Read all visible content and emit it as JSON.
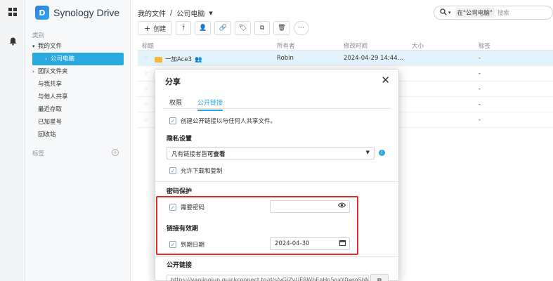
{
  "app": {
    "name": "Synology Drive",
    "logo_letter": "D"
  },
  "rail": {
    "icons": [
      "grid-icon",
      "bell-icon"
    ]
  },
  "sidebar": {
    "category_label": "类别",
    "items": [
      {
        "label": "我的文件",
        "arrow": "▾"
      },
      {
        "label": "公司电脑",
        "arrow": "›",
        "active": true
      },
      {
        "label": "团队文件夹",
        "arrow": "›"
      },
      {
        "label": "与我共享"
      },
      {
        "label": "与他人共享"
      },
      {
        "label": "最近存取"
      },
      {
        "label": "已加星号"
      },
      {
        "label": "回收站"
      }
    ],
    "tags_label": "标签"
  },
  "breadcrumb": {
    "root": "我的文件",
    "sep": "/",
    "current": "公司电脑"
  },
  "search": {
    "scope": "在\"公司电脑\"",
    "placeholder": "搜索"
  },
  "toolbar": {
    "create_label": "创建"
  },
  "table": {
    "headers": {
      "name": "标题",
      "owner": "所有者",
      "modified": "修改时间",
      "size": "大小",
      "tags": "标签"
    },
    "rows": [
      {
        "name": "一加Ace3",
        "owner": "Robin",
        "modified": "2024-04-29 14:44...",
        "size": "",
        "tags": "-"
      },
      {
        "tags": "-"
      },
      {
        "tags": "-"
      },
      {
        "tags": "-"
      },
      {
        "tags": "-"
      }
    ]
  },
  "dialog": {
    "title": "分享",
    "tabs": [
      "权限",
      "公开链接"
    ],
    "create_link_label": "创建公开链接以与任何人共享文件。",
    "privacy_header": "隐私设置",
    "privacy_select_prefix": "凡有链接者皆",
    "privacy_select_bold": "可查看",
    "allow_download_label": "允许下载和复制",
    "password_header": "密码保护",
    "require_password_label": "需要密码",
    "password_value": "",
    "expiry_header": "链接有效期",
    "expiry_label": "到期日期",
    "expiry_date": "2024-04-30",
    "public_link_header": "公开链接",
    "public_link_url": "https://yaojingjun.quickconnect.to/d/s/vGJZvUE8WhEaHn5qxY0xeoShMe"
  },
  "colors": {
    "accent": "#2aa9e0",
    "highlight": "#e02b27"
  }
}
